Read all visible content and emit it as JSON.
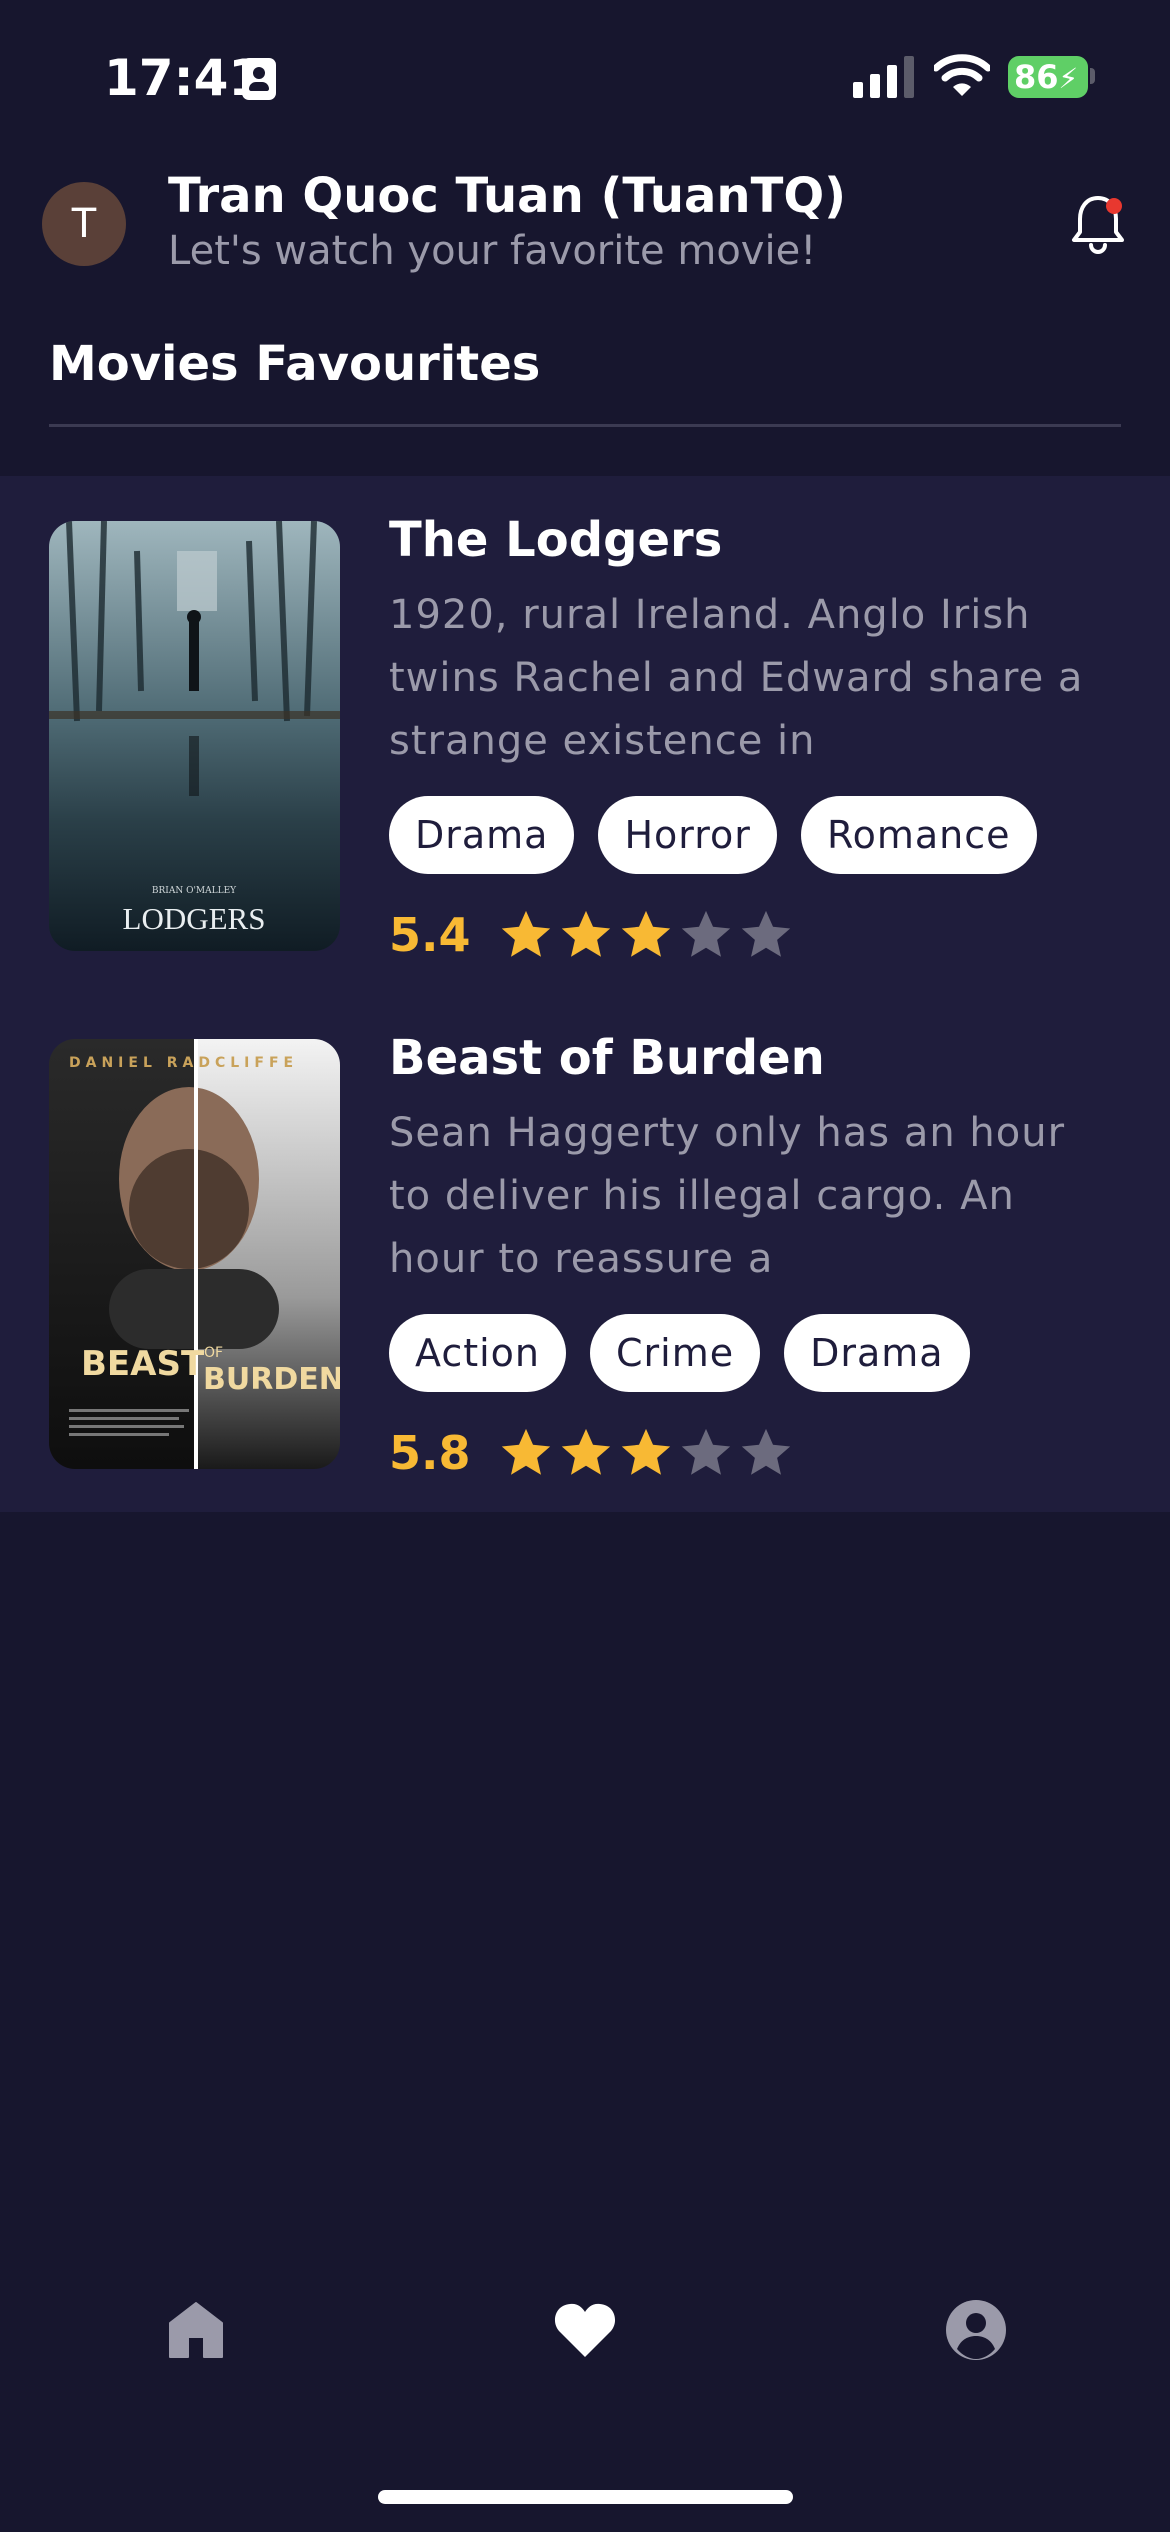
{
  "status_bar": {
    "time": "17:41",
    "battery": "86",
    "icons": [
      "contact-card-icon",
      "cellular-signal-icon",
      "wifi-icon",
      "battery-charging-icon"
    ]
  },
  "header": {
    "avatar_initial": "T",
    "user_name": "Tran Quoc Tuan (TuanTQ)",
    "subtitle": "Let's watch your favorite movie!",
    "notification_icon": "bell-icon",
    "has_unread": true
  },
  "section_title": "Movies Favourites",
  "movies": [
    {
      "title": "The Lodgers",
      "overview": "1920, rural Ireland. Anglo Irish twins Rachel and Edward share a strange existence in",
      "genres": [
        "Drama",
        "Horror",
        "Romance"
      ],
      "rating": "5.4",
      "stars_filled": 3,
      "stars_total": 5,
      "poster_text": "LODGERS"
    },
    {
      "title": "Beast of Burden",
      "overview": "Sean Haggerty only has an hour to deliver his illegal cargo. An hour to reassure a",
      "genres": [
        "Action",
        "Crime",
        "Drama"
      ],
      "rating": "5.8",
      "stars_filled": 3,
      "stars_total": 5,
      "poster_top_text": "DANIEL RADCLIFFE",
      "poster_title_left": "BEAST",
      "poster_title_of": "OF",
      "poster_title_right": "BURDEN"
    }
  ],
  "bottom_nav": {
    "items": [
      "home-icon",
      "heart-icon",
      "profile-icon"
    ],
    "active": "heart-icon"
  },
  "colors": {
    "background": "#17162e",
    "list_background": "#1f1d3c",
    "rating": "#f8b934",
    "star_empty": "#6c6b7e",
    "muted_text": "#9b9aaa",
    "battery": "#5fcf66",
    "notification_dot": "#e8382f"
  }
}
